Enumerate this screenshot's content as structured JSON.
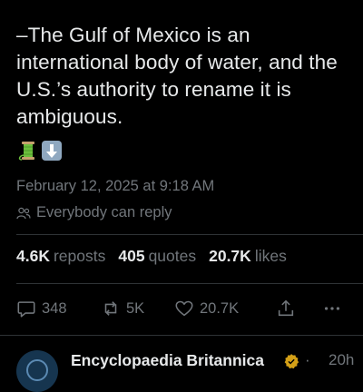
{
  "post": {
    "text": "–The Gulf of Mexico is an international body of water, and the U.S.’s authority to rename it is ambiguous.",
    "emojis": [
      "thread-spool-emoji",
      "down-arrow-emoji"
    ],
    "timestamp": "February 12, 2025 at 9:18 AM",
    "reply_setting": "Everybody can reply"
  },
  "stats": {
    "reposts_count": "4.6K",
    "reposts_label": "reposts",
    "quotes_count": "405",
    "quotes_label": "quotes",
    "likes_count": "20.7K",
    "likes_label": "likes"
  },
  "actions": {
    "reply_count": "348",
    "repost_count": "5K",
    "like_count": "20.7K"
  },
  "next_reply": {
    "author_name": "Encyclopaedia Britannica",
    "separator": "·",
    "time": "20h"
  },
  "colors": {
    "background": "#000000",
    "text_primary": "#e7e9ea",
    "text_secondary": "#71767b",
    "divider": "#2f3336",
    "verified_badge": "#d4a017"
  }
}
